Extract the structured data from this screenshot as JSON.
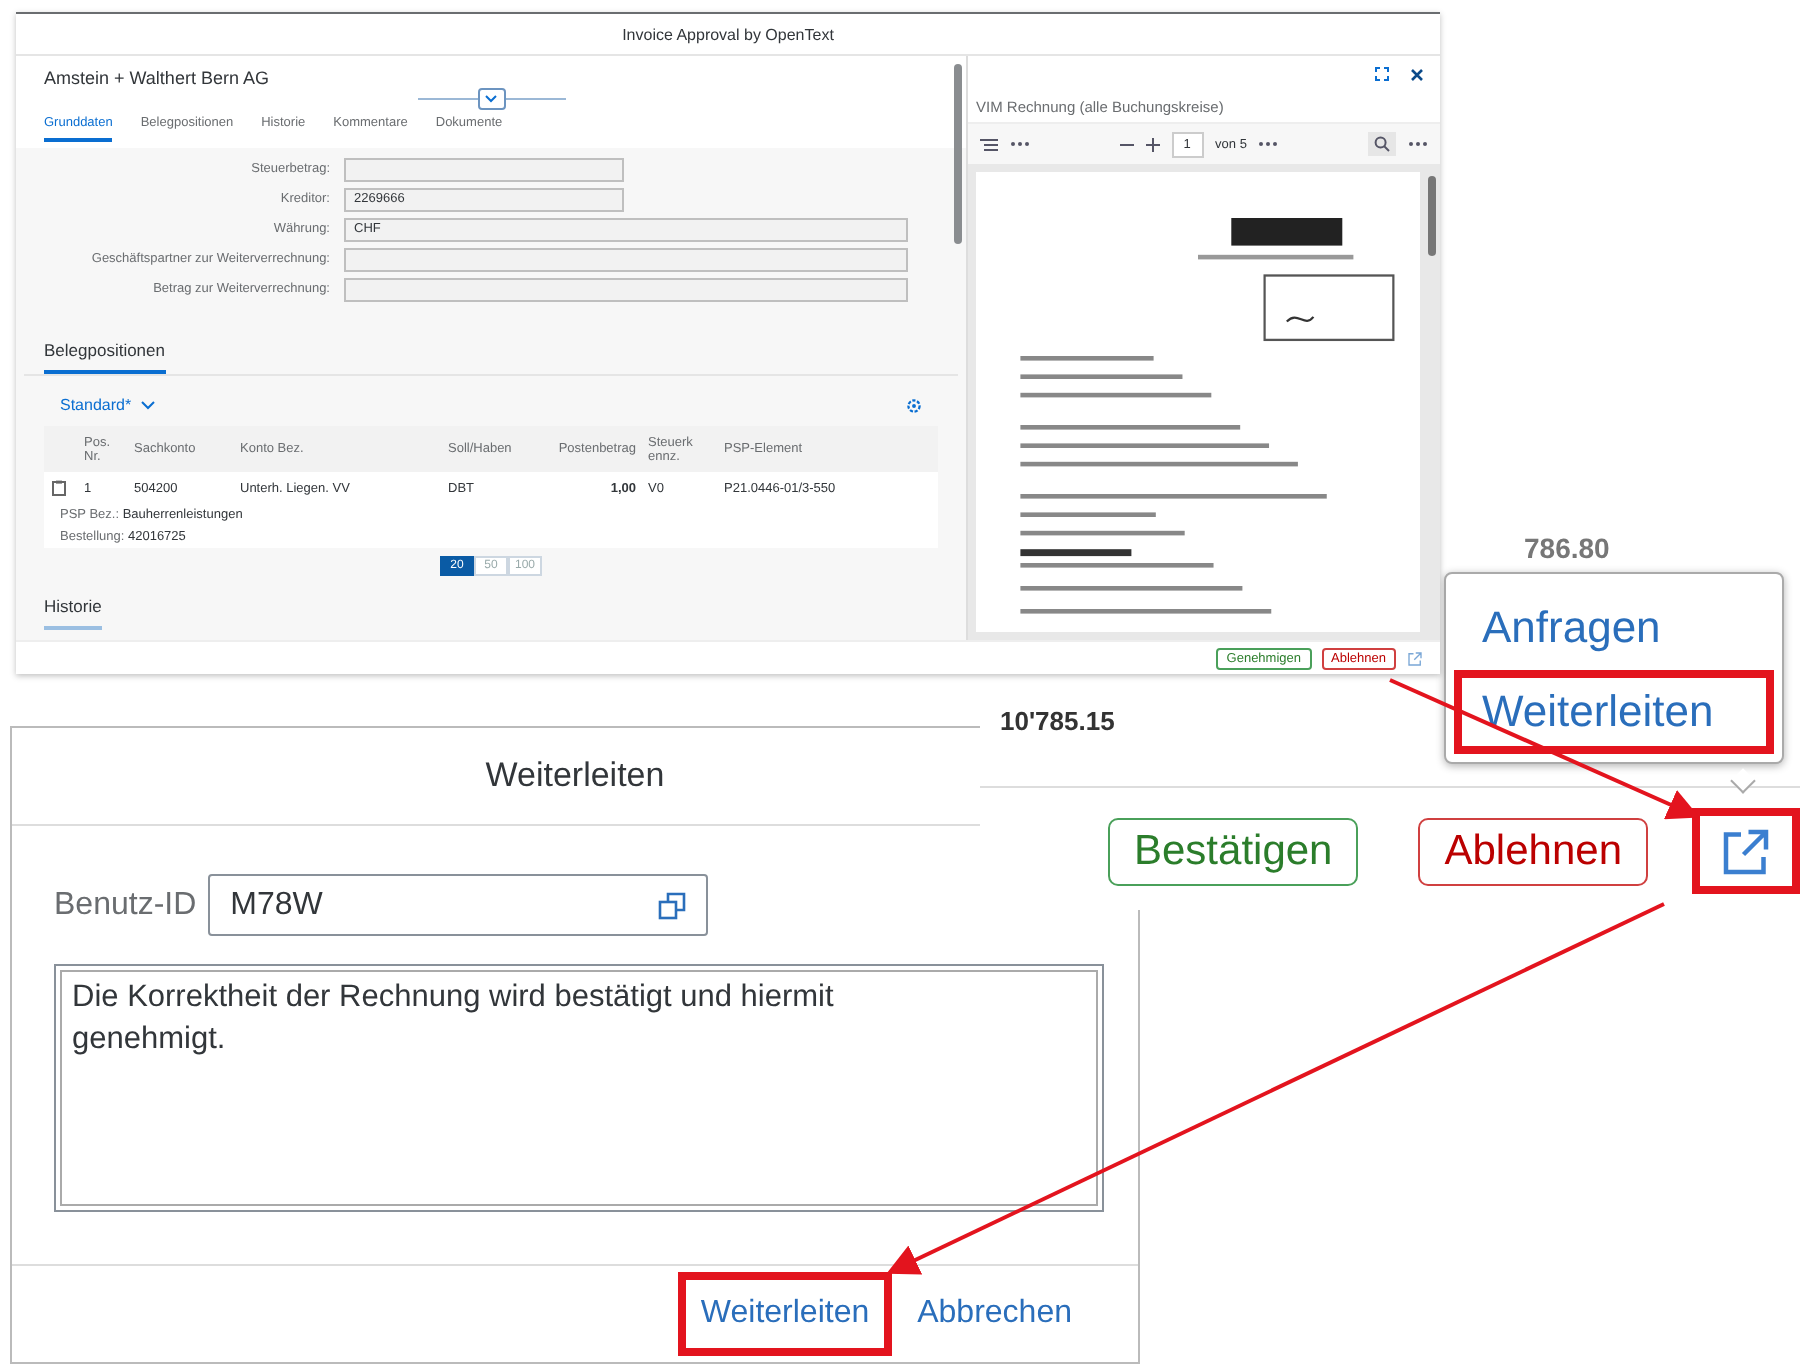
{
  "app": {
    "title": "Invoice Approval by OpenText",
    "company": "Amstein + Walthert Bern AG",
    "tabs": [
      {
        "label": "Grunddaten",
        "selected": true
      },
      {
        "label": "Belegpositionen",
        "selected": false
      },
      {
        "label": "Historie",
        "selected": false
      },
      {
        "label": "Kommentare",
        "selected": false
      },
      {
        "label": "Dokumente",
        "selected": false
      }
    ],
    "fields": [
      {
        "label": "Steuerbetrag:",
        "kind": "short"
      },
      {
        "label": "Kreditor:",
        "value": "2269666",
        "kind": "short"
      },
      {
        "label": "Währung:",
        "value": "CHF",
        "kind": "long"
      },
      {
        "label": "Geschäftspartner zur Weiterverrechnung:",
        "kind": "long"
      },
      {
        "label": "Betrag zur Weiterverrechnung:",
        "kind": "long"
      }
    ],
    "items_section": {
      "title": "Belegpositionen",
      "variant": "Standard*",
      "columns": [
        "Pos. Nr.",
        "Sachkonto",
        "Konto Bez.",
        "Soll/Haben",
        "Postenbetrag",
        "Steuerk ennz.",
        "PSP-Element"
      ],
      "rows": [
        {
          "cells": [
            "1",
            "504200",
            "Unterh. Liegen. VV",
            "DBT",
            "1,00",
            "V0",
            "P21.0446-01/3-550"
          ],
          "details": [
            {
              "label": "PSP Bez.:",
              "value": "Bauherrenleistungen"
            },
            {
              "label": "Bestellung:",
              "value": "42016725"
            }
          ]
        }
      ],
      "page_sizes": [
        {
          "label": "20",
          "selected": true
        },
        {
          "label": "50",
          "selected": false
        },
        {
          "label": "100",
          "selected": false
        }
      ]
    },
    "history_title": "Historie",
    "viewer": {
      "title": "VIM Rechnung (alle Buchungskreise)",
      "page": "1",
      "page_of": "von 5"
    },
    "footer_buttons": [
      {
        "label": "Genehmigen",
        "kind": "accept"
      },
      {
        "label": "Ablehnen",
        "kind": "reject"
      }
    ]
  },
  "zoom_panel": {
    "amounts": [
      "786.80",
      "10'785.15"
    ],
    "menu": [
      {
        "label": "Anfragen",
        "highlighted": false
      },
      {
        "label": "Weiterleiten",
        "highlighted": true
      }
    ],
    "buttons": [
      {
        "label": "Bestätigen",
        "kind": "accept"
      },
      {
        "label": "Ablehnen",
        "kind": "reject"
      }
    ],
    "share_highlighted": true
  },
  "dialog": {
    "title": "Weiterleiten",
    "user_label": "Benutz-ID",
    "user_value": "M78W",
    "comment": "Die Korrektheit der Rechnung wird bestätigt und hiermit genehmigt.",
    "buttons": [
      {
        "label": "Weiterleiten",
        "highlighted": true
      },
      {
        "label": "Abbrechen",
        "highlighted": false
      }
    ]
  }
}
